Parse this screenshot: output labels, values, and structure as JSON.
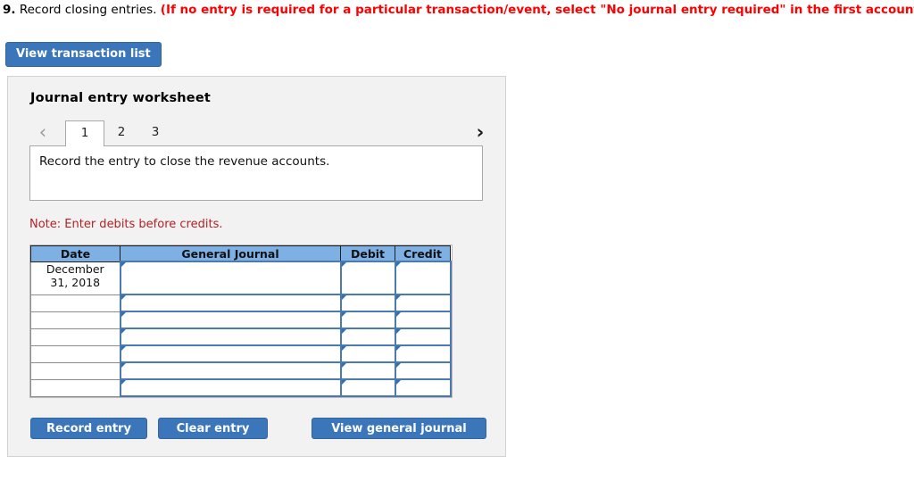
{
  "question": {
    "number": "9.",
    "text": "Record closing entries.",
    "red_note": "(If no entry is required for a particular transaction/event, select \"No journal entry required\" in the first account field.)"
  },
  "toolbar": {
    "view_transaction_list_label": "View transaction list"
  },
  "worksheet": {
    "title": "Journal entry worksheet",
    "tabs": [
      {
        "label": "1",
        "active": true
      },
      {
        "label": "2",
        "active": false
      },
      {
        "label": "3",
        "active": false
      }
    ],
    "prev_icon": "chevron-left-icon",
    "next_icon": "chevron-right-icon",
    "prev_glyph": "‹",
    "next_glyph": "›",
    "instruction": "Record the entry to close the revenue accounts.",
    "note": "Note: Enter debits before credits."
  },
  "table": {
    "headers": [
      "Date",
      "General Journal",
      "Debit",
      "Credit"
    ],
    "rows": [
      {
        "date_line1": "December",
        "date_line2": "31, 2018",
        "general_journal": "",
        "debit": "",
        "credit": ""
      },
      {
        "date_line1": "",
        "date_line2": "",
        "general_journal": "",
        "debit": "",
        "credit": ""
      },
      {
        "date_line1": "",
        "date_line2": "",
        "general_journal": "",
        "debit": "",
        "credit": ""
      },
      {
        "date_line1": "",
        "date_line2": "",
        "general_journal": "",
        "debit": "",
        "credit": ""
      },
      {
        "date_line1": "",
        "date_line2": "",
        "general_journal": "",
        "debit": "",
        "credit": ""
      },
      {
        "date_line1": "",
        "date_line2": "",
        "general_journal": "",
        "debit": "",
        "credit": ""
      },
      {
        "date_line1": "",
        "date_line2": "",
        "general_journal": "",
        "debit": "",
        "credit": ""
      }
    ]
  },
  "actions": {
    "record_entry_label": "Record entry",
    "clear_entry_label": "Clear entry",
    "view_general_journal_label": "View general journal"
  },
  "colors": {
    "button_blue": "#3b76ba",
    "header_blue": "#7eb0e3",
    "note_red": "#b42025",
    "alert_red": "#ff0000",
    "panel_gray": "#f2f2f2",
    "cell_border_blue": "#4a7ab0"
  }
}
